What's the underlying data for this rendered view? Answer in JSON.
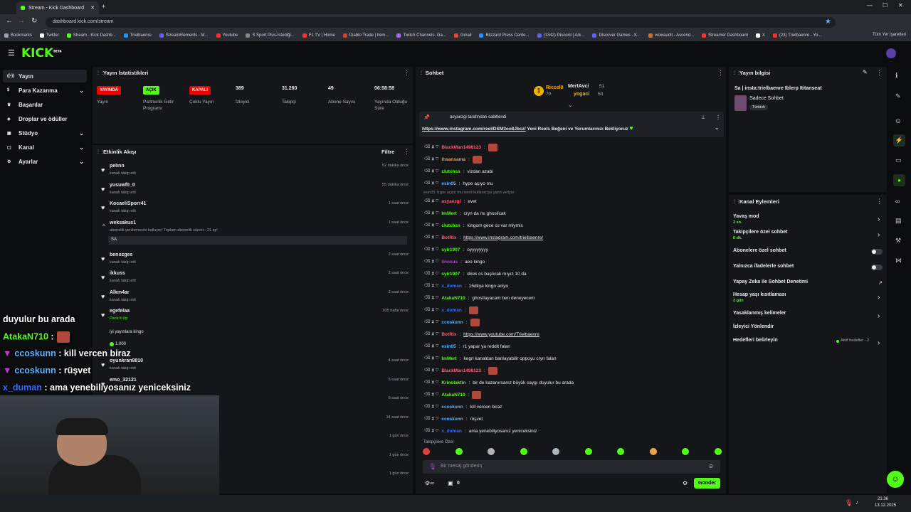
{
  "browser": {
    "tab_title": "Stream - Kick Dashboard",
    "new_tab": "+",
    "url": "dashboard.kick.com/stream",
    "bookmarks": [
      "Bookmarks",
      "Twitter",
      "Stream - Kick Dashb...",
      "Trielbaenre",
      "StreamElements - M...",
      "Youtube",
      "S Sport Plus-İstediği...",
      "F1 TV | Home",
      "Diablo Trade | Item...",
      "Twitch Channels, Ga...",
      "Gmail",
      "Blizzard Press Cente...",
      "(1342) Discord | Ark...",
      "Discover Games - K...",
      "wowaudit - Ascend...",
      "Streamer Dashboard",
      "X",
      "(23) Trielbaenre - Yo..."
    ],
    "all_bookmarks": "Tüm Yer İşaretleri"
  },
  "kick": {
    "logo": "KICK",
    "logo_sup": "BETA"
  },
  "sidebar": {
    "items": [
      {
        "label": "Yayın",
        "icon": "broadcast-icon",
        "chev": ""
      },
      {
        "label": "Para Kazanma",
        "icon": "dollar-icon",
        "chev": "⌄"
      },
      {
        "label": "Başarılar",
        "icon": "trophy-icon",
        "chev": ""
      },
      {
        "label": "Droplar ve ödüller",
        "icon": "gift-icon",
        "chev": ""
      },
      {
        "label": "Stüdyo",
        "icon": "studio-icon",
        "chev": "⌄"
      },
      {
        "label": "Kanal",
        "icon": "channel-icon",
        "chev": "⌄"
      },
      {
        "label": "Ayarlar",
        "icon": "gear-icon",
        "chev": "⌄"
      }
    ]
  },
  "stats": {
    "title": "Yayın İstatistikleri",
    "items": [
      {
        "badge": "YAYINDA",
        "label": "Yayın",
        "color": "#eb0400"
      },
      {
        "badge": "AÇIK",
        "label": "Partnerlik Gelir Programı",
        "color": "#53fc18"
      },
      {
        "badge": "KAPALI",
        "label": "Çoklu Yayın",
        "color": "#eb0400"
      },
      {
        "value": "389",
        "label": "İzleyici"
      },
      {
        "value": "31.260",
        "label": "Takipçi"
      },
      {
        "value": "49",
        "label": "Abone Sayısı"
      },
      {
        "value": "06:58:58",
        "label": "Yayında Olduğu Süre"
      }
    ]
  },
  "activity": {
    "title": "Etkinlik Akışı",
    "filter": "Filtre",
    "items": [
      {
        "name": "pelinn",
        "sub": "kanalı takip etti",
        "time": "52 dakika önce"
      },
      {
        "name": "yusuwf0_0",
        "sub": "kanalı takip etti",
        "time": "55 dakika önce"
      },
      {
        "name": "KocaeliSporr41",
        "sub": "kanalı takip etti",
        "time": "1 saat önce"
      },
      {
        "name": "weksakus1",
        "sub": "abonelik yenilemesini kutluyor! Toplam abonelik süresi - 21 ay!",
        "time": "1 saat önce",
        "msg": "SA"
      },
      {
        "name": "benozges",
        "sub": "kanalı takip etti",
        "time": "2 saat önce"
      },
      {
        "name": "ikkuss",
        "sub": "kanalı takip etti",
        "time": "2 saat önce"
      },
      {
        "name": "Alkm4ar",
        "sub": "kanalı takip etti",
        "time": "3 saat önce"
      },
      {
        "name": "egefelaa",
        "sub": "Pack It Up",
        "time": "935 hafta önce",
        "extra": "iyi yayınlara kingo",
        "amount": "1.000"
      },
      {
        "name": "oyunkran8810",
        "sub": "kanalı takip etti",
        "time": "4 saat önce"
      },
      {
        "name": "emo_32121",
        "sub": "",
        "time": "5 saat önce"
      },
      {
        "name": "",
        "sub": "",
        "time": "6 saat önce"
      },
      {
        "name": "",
        "sub": "",
        "time": "14 saat önce"
      },
      {
        "name": "",
        "sub": "",
        "time": "1 gün önce"
      },
      {
        "name": "",
        "sub": "",
        "time": "1 gün önce"
      },
      {
        "name": "",
        "sub": "",
        "time": "1 gün önce"
      }
    ]
  },
  "chat": {
    "title": "Sohbet",
    "top_gifters": [
      {
        "name": "Riccel0",
        "value": "70"
      },
      {
        "name": "MertAvci",
        "value": "51"
      },
      {
        "name": "yogaci",
        "value": "50"
      }
    ],
    "pinned_by": "asyaezgi tarafından sabitlendi",
    "pinned_link": "https://www.instagram.com/reel/DSM3oo8Jbcz/",
    "pinned_text": " Yeni Reels Beğeni ve Yorumlarınızı Bekliyoruz",
    "reply_note": "esin05: hype açıyo mu isimli kullanıcıya yanıt veriyor",
    "messages": [
      {
        "user": "BlackMan1498123",
        "color": "#ff5c7a",
        "text": "",
        "emote": true
      },
      {
        "user": "ihsansama",
        "color": "#f0a050",
        "text": "",
        "emote": true
      },
      {
        "user": "clutchss",
        "color": "#53fc18",
        "text": "vizdan azabi"
      },
      {
        "user": "esin05",
        "color": "#5cb4ff",
        "text": "hype açıyo mu"
      },
      {
        "user": "asyaezgi",
        "color": "#ff5c7a",
        "text": "evet"
      },
      {
        "user": "ImMert",
        "color": "#53fc18",
        "text": "cryn da mı ghoslicak"
      },
      {
        "user": "clutchss",
        "color": "#53fc18",
        "text": "kingom gece cs var miymis"
      },
      {
        "user": "BotRix",
        "color": "#ff5c7a",
        "text": "https://www.instagram.com/trielbaenre/",
        "link": true
      },
      {
        "user": "syir1907",
        "color": "#53fc18",
        "text": "oyyyyyyyy"
      },
      {
        "user": "ilnoxus",
        "color": "#c23ad6",
        "text": "aeo kingo"
      },
      {
        "user": "syir1907",
        "color": "#53fc18",
        "text": "direk cs başlıcak mıyız 10 da"
      },
      {
        "user": "x_duman",
        "color": "#3a6bff",
        "text": "15dkya kingo aciyo"
      },
      {
        "user": "AtakaN710",
        "color": "#53fc18",
        "text": "ghostlayacam ben deneyecem"
      },
      {
        "user": "x_duman",
        "color": "#3a6bff",
        "text": "",
        "emote": true
      },
      {
        "user": "ccoskunn",
        "color": "#5cb4ff",
        "text": "",
        "emote": true
      },
      {
        "user": "BotRix",
        "color": "#ff5c7a",
        "text": "https://www.youtube.com/Trielbaenre",
        "link": true
      },
      {
        "user": "esin05",
        "color": "#5cb4ff",
        "text": "r1 yapar ya reddit falan"
      },
      {
        "user": "ImMert",
        "color": "#53fc18",
        "text": "kegri kanaldan banlayabilir oppoyu cryn falan"
      },
      {
        "user": "BlackMan1498123",
        "color": "#ff5c7a",
        "text": "",
        "emote": true
      },
      {
        "user": "Krinolaktin",
        "color": "#53fc18",
        "text": "bir de kazanırsanız büyük saygı duyulur bu arada"
      },
      {
        "user": "AtakaN710",
        "color": "#53fc18",
        "text": "",
        "emote": true
      },
      {
        "user": "ccoskunn",
        "color": "#5cb4ff",
        "text": "kill vercen biraz"
      },
      {
        "user": "ccoskunn",
        "color": "#5cb4ff",
        "text": "rüşvet"
      },
      {
        "user": "x_duman",
        "color": "#3a6bff",
        "text": "ama yenebiliyosanız yeniceksiniz"
      }
    ],
    "followers_only": "Takipçilere Özel",
    "input_placeholder": "Bir mesaj gönderin",
    "points": "0",
    "send": "Gönder"
  },
  "stream_info": {
    "title": "Yayın bilgisi",
    "stream_title": "Sa | insta:trielbaenre Iblerp Ititanseat",
    "category": "Sadece Sohbet",
    "language": "Türkish"
  },
  "channel_actions": {
    "title": "Kanal Eylemleri",
    "items": [
      {
        "label": "Yavaş mod",
        "sub": "2 sn.",
        "control": "chev"
      },
      {
        "label": "Takipçilere özel sohbet",
        "sub": "6 dk.",
        "control": "chev"
      },
      {
        "label": "Abonelere özel sohbet",
        "sub": "",
        "control": "toggle"
      },
      {
        "label": "Yalnızca ifadelerle sohbet",
        "sub": "",
        "control": "toggle"
      },
      {
        "label": "Yapay Zeka ile Sohbet Denetimi",
        "sub": "",
        "control": "ext"
      },
      {
        "label": "Hesap yaşı kısıtlaması",
        "sub": "2 gün",
        "control": "chev"
      },
      {
        "label": "Yasaklanmış kelimeler",
        "sub": "",
        "control": "chev"
      },
      {
        "label": "İzleyici Yönlendir",
        "sub": "",
        "control": ""
      },
      {
        "label": "Hedefleri belirleyin",
        "sub": "",
        "control": "chev",
        "note": "Aktif hedefler - 2"
      }
    ]
  },
  "overlay_chat": [
    {
      "user": "",
      "text": "duyulur bu arada",
      "color": "#ffffff"
    },
    {
      "user": "AtakaN710",
      "text": " :",
      "color": "#53fc18",
      "emote": true
    },
    {
      "user": "ccoskunn",
      "text": " : kill vercen biraz",
      "color": "#5cb4ff"
    },
    {
      "user": "ccoskunn",
      "text": " : rüşvet",
      "color": "#5cb4ff"
    },
    {
      "user": "x_duman",
      "text": " : ama yenebiliyosanız yeniceksiniz",
      "color": "#3a6bff"
    }
  ],
  "taskbar": {
    "time": "21:36",
    "date": "13.12.2025"
  }
}
